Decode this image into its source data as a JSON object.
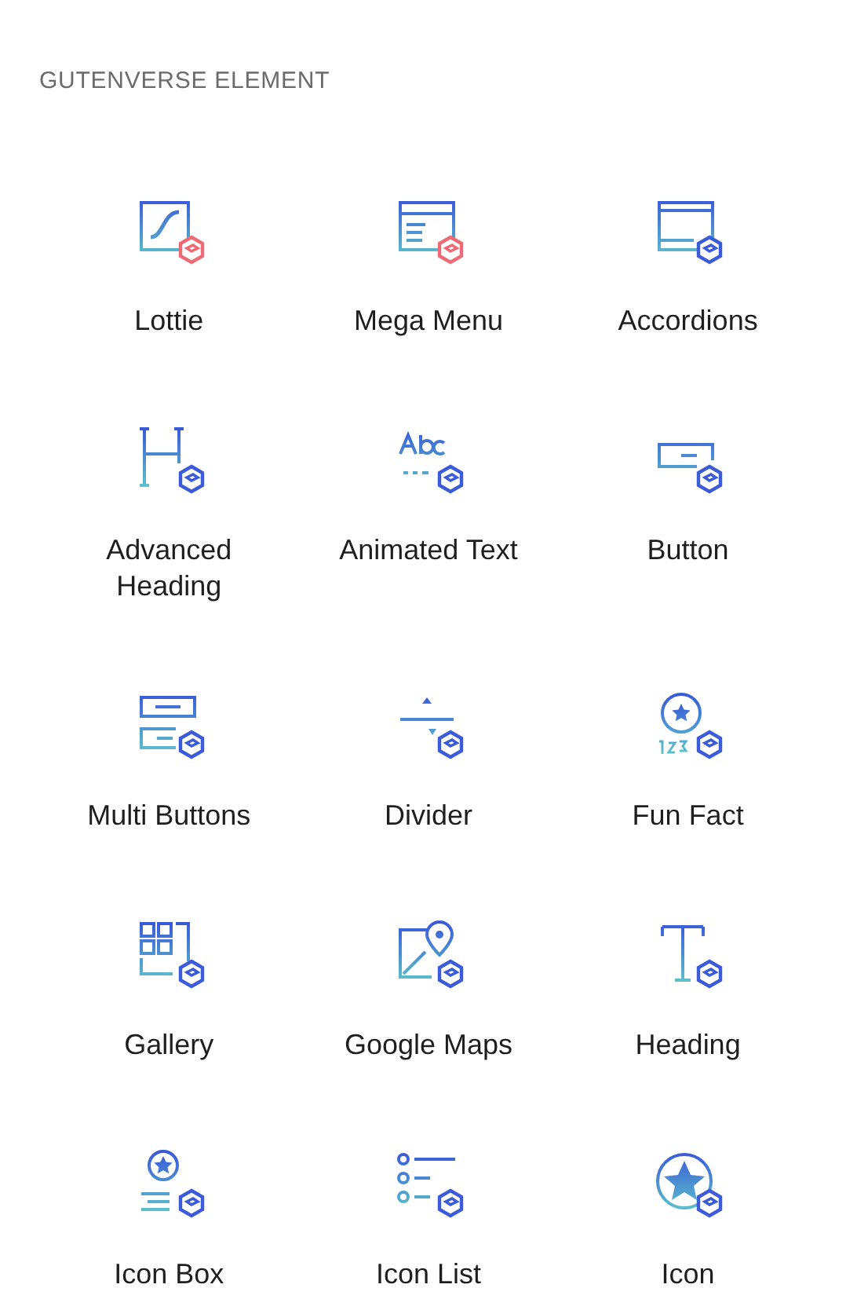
{
  "section_title": "GUTENVERSE ELEMENT",
  "elements": [
    {
      "label": "Lottie",
      "kind": "lottie",
      "color": "#f06a75"
    },
    {
      "label": "Mega Menu",
      "kind": "megamenu",
      "color": "#f06a75"
    },
    {
      "label": "Accordions",
      "kind": "accordion",
      "color": "#3b5bdb"
    },
    {
      "label": "Advanced Heading",
      "kind": "advheading",
      "color": "#3b5bdb"
    },
    {
      "label": "Animated Text",
      "kind": "animtext",
      "color": "#3b5bdb"
    },
    {
      "label": "Button",
      "kind": "button",
      "color": "#3b5bdb"
    },
    {
      "label": "Multi Buttons",
      "kind": "multibuttons",
      "color": "#3b5bdb"
    },
    {
      "label": "Divider",
      "kind": "divider",
      "color": "#3b5bdb"
    },
    {
      "label": "Fun Fact",
      "kind": "funfact",
      "color": "#3b5bdb"
    },
    {
      "label": "Gallery",
      "kind": "gallery",
      "color": "#3b5bdb"
    },
    {
      "label": "Google Maps",
      "kind": "maps",
      "color": "#3b5bdb"
    },
    {
      "label": "Heading",
      "kind": "heading",
      "color": "#3b5bdb"
    },
    {
      "label": "Icon Box",
      "kind": "iconbox",
      "color": "#3b5bdb"
    },
    {
      "label": "Icon List",
      "kind": "iconlist",
      "color": "#3b5bdb"
    },
    {
      "label": "Icon",
      "kind": "icon",
      "color": "#3b5bdb"
    }
  ]
}
